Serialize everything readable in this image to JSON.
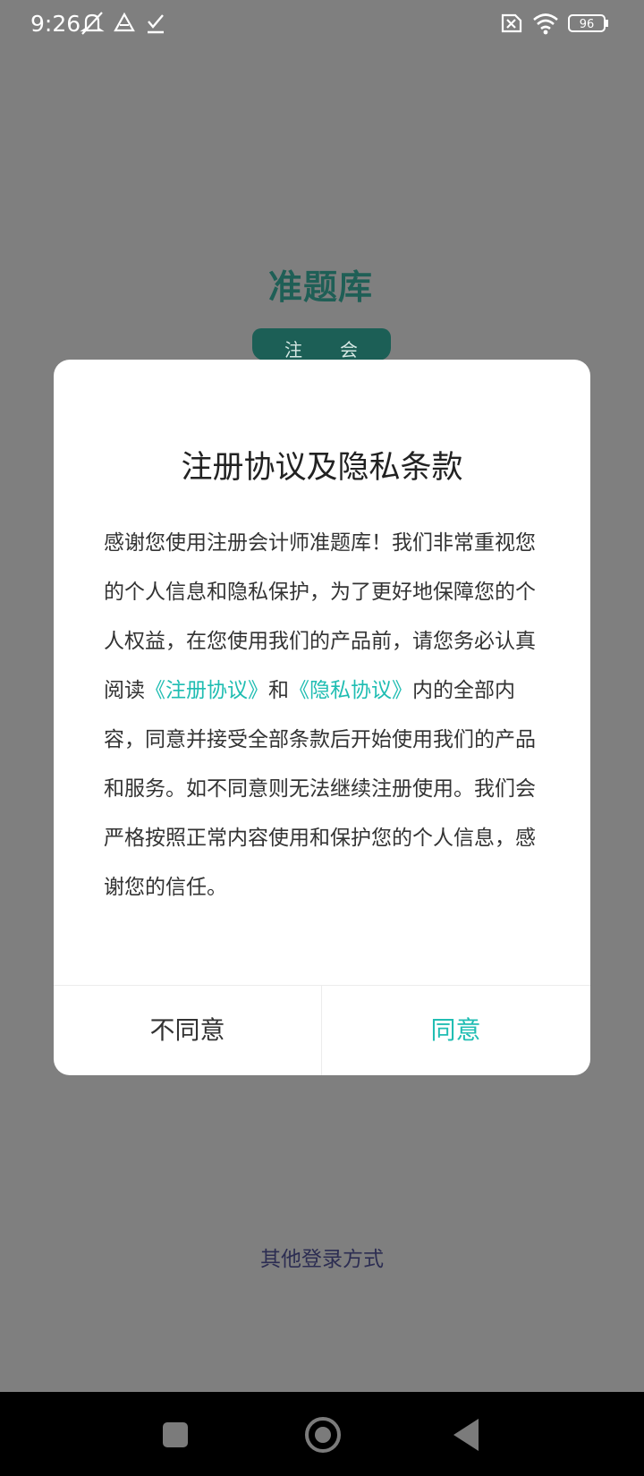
{
  "status_bar": {
    "time": "9:26",
    "battery": "96",
    "icons": [
      "mute-bell-icon",
      "drive-icon",
      "download-done-icon",
      "sim-x-icon",
      "wifi-icon",
      "battery-icon"
    ]
  },
  "background": {
    "logo_text": "准题库",
    "tag_left": "注",
    "tag_right": "会",
    "other_login": "其他登录方式"
  },
  "dialog": {
    "title": "注册协议及隐私条款",
    "body_part1": "感谢您使用注册会计师准题库！我们非常重视您的个人信息和隐私保护，为了更好地保障您的个人权益，在您使用我们的产品前，请您务必认真阅读",
    "link_register": "《注册协议》",
    "body_and": "和",
    "link_privacy": "《隐私协议》",
    "body_part2": "内的全部内容，同意并接受全部条款后开始使用我们的产品和服务。如不同意则无法继续注册使用。我们会严格按照正常内容使用和保护您的个人信息，感谢您的信任。",
    "disagree_label": "不同意",
    "agree_label": "同意"
  },
  "colors": {
    "accent": "#20bdb3",
    "overlay": "#7f7f7f",
    "logo": "#1f5f56"
  }
}
